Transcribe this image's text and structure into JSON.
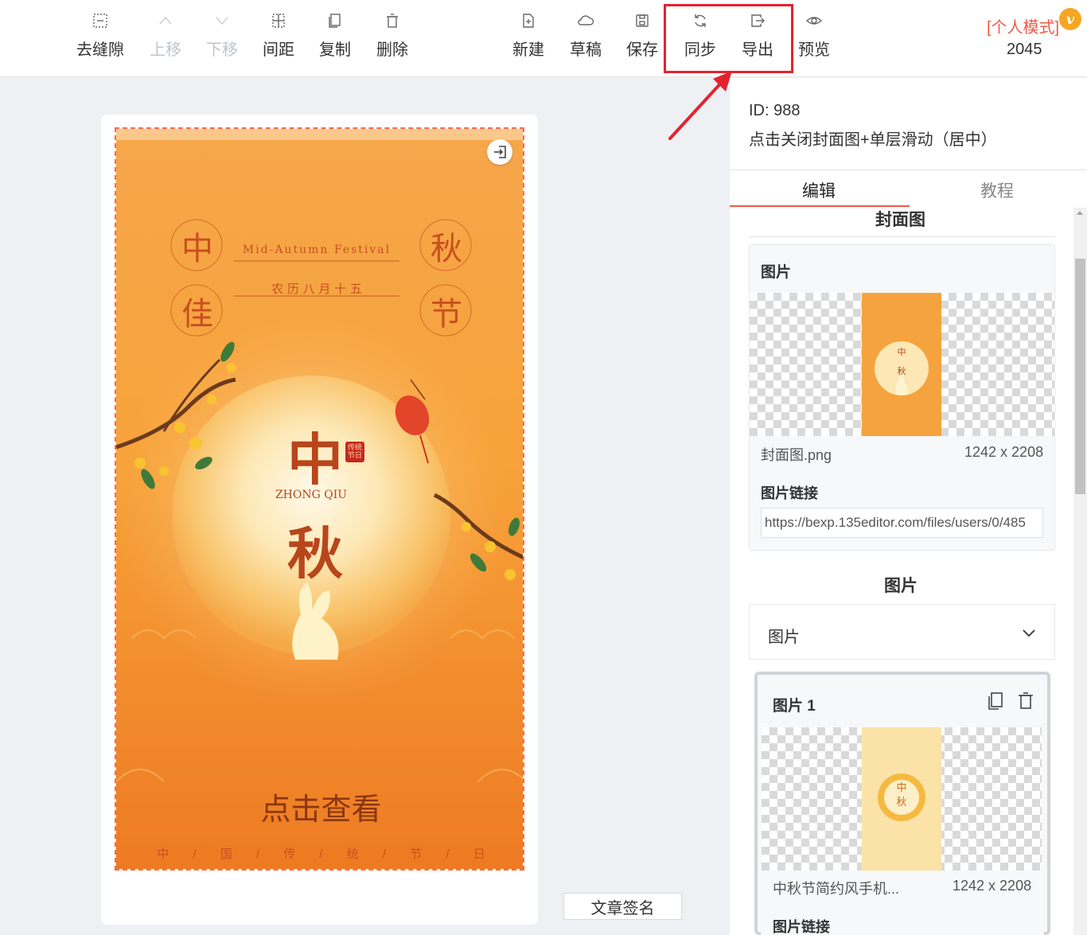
{
  "toolbar": {
    "items": [
      {
        "label": "去缝隙",
        "icon": "gap-remove-icon",
        "enabled": true
      },
      {
        "label": "上移",
        "icon": "chevron-up-icon",
        "enabled": false
      },
      {
        "label": "下移",
        "icon": "chevron-down-icon",
        "enabled": false
      },
      {
        "label": "间距",
        "icon": "spacing-icon",
        "enabled": true
      },
      {
        "label": "复制",
        "icon": "copy-icon",
        "enabled": true
      },
      {
        "label": "删除",
        "icon": "trash-icon",
        "enabled": true
      },
      {
        "label": "新建",
        "icon": "new-file-icon",
        "enabled": true
      },
      {
        "label": "草稿",
        "icon": "cloud-icon",
        "enabled": true
      },
      {
        "label": "保存",
        "icon": "save-icon",
        "enabled": true
      },
      {
        "label": "同步",
        "icon": "sync-icon",
        "enabled": true
      },
      {
        "label": "导出",
        "icon": "export-icon",
        "enabled": true
      },
      {
        "label": "预览",
        "icon": "eye-icon",
        "enabled": true
      }
    ],
    "mode_label": "[个人模式]",
    "mode_badge": "v",
    "mode_number": "2045"
  },
  "highlight": {
    "color": "#e4232d"
  },
  "poster": {
    "corner_chars": [
      "中",
      "秋",
      "佳",
      "节"
    ],
    "festival_en": "Mid-Autumn Festival",
    "lunar_date": "农 历 八 月 十 五",
    "big_char_1": "中",
    "seal_text": "传统节日",
    "pinyin": "ZHONG QIU",
    "big_char_2": "秋",
    "cta": "点击查看",
    "footer": "中 / 国 / 传 / 统 / 节 / 日",
    "colors": {
      "primary": "#f07a20",
      "text": "#b8461a"
    }
  },
  "signature": "文章签名",
  "panel": {
    "id_line": "ID: 988",
    "title": "点击关闭封面图+单层滑动（居中）",
    "tabs": [
      "编辑",
      "教程"
    ],
    "active_tab": "编辑",
    "cover_section": "封面图",
    "cover_group": {
      "label": "图片",
      "file_name": "封面图.png",
      "file_size": "1242 x 2208",
      "link_label": "图片链接",
      "link_value": "https://bexp.135editor.com/files/users/0/485"
    },
    "images_section": "图片",
    "select_value": "图片",
    "item": {
      "title": "图片 1",
      "file_name": "中秋节简约风手机...",
      "file_size": "1242 x 2208",
      "link_label": "图片链接"
    }
  },
  "accent_color": "#ef5a45"
}
